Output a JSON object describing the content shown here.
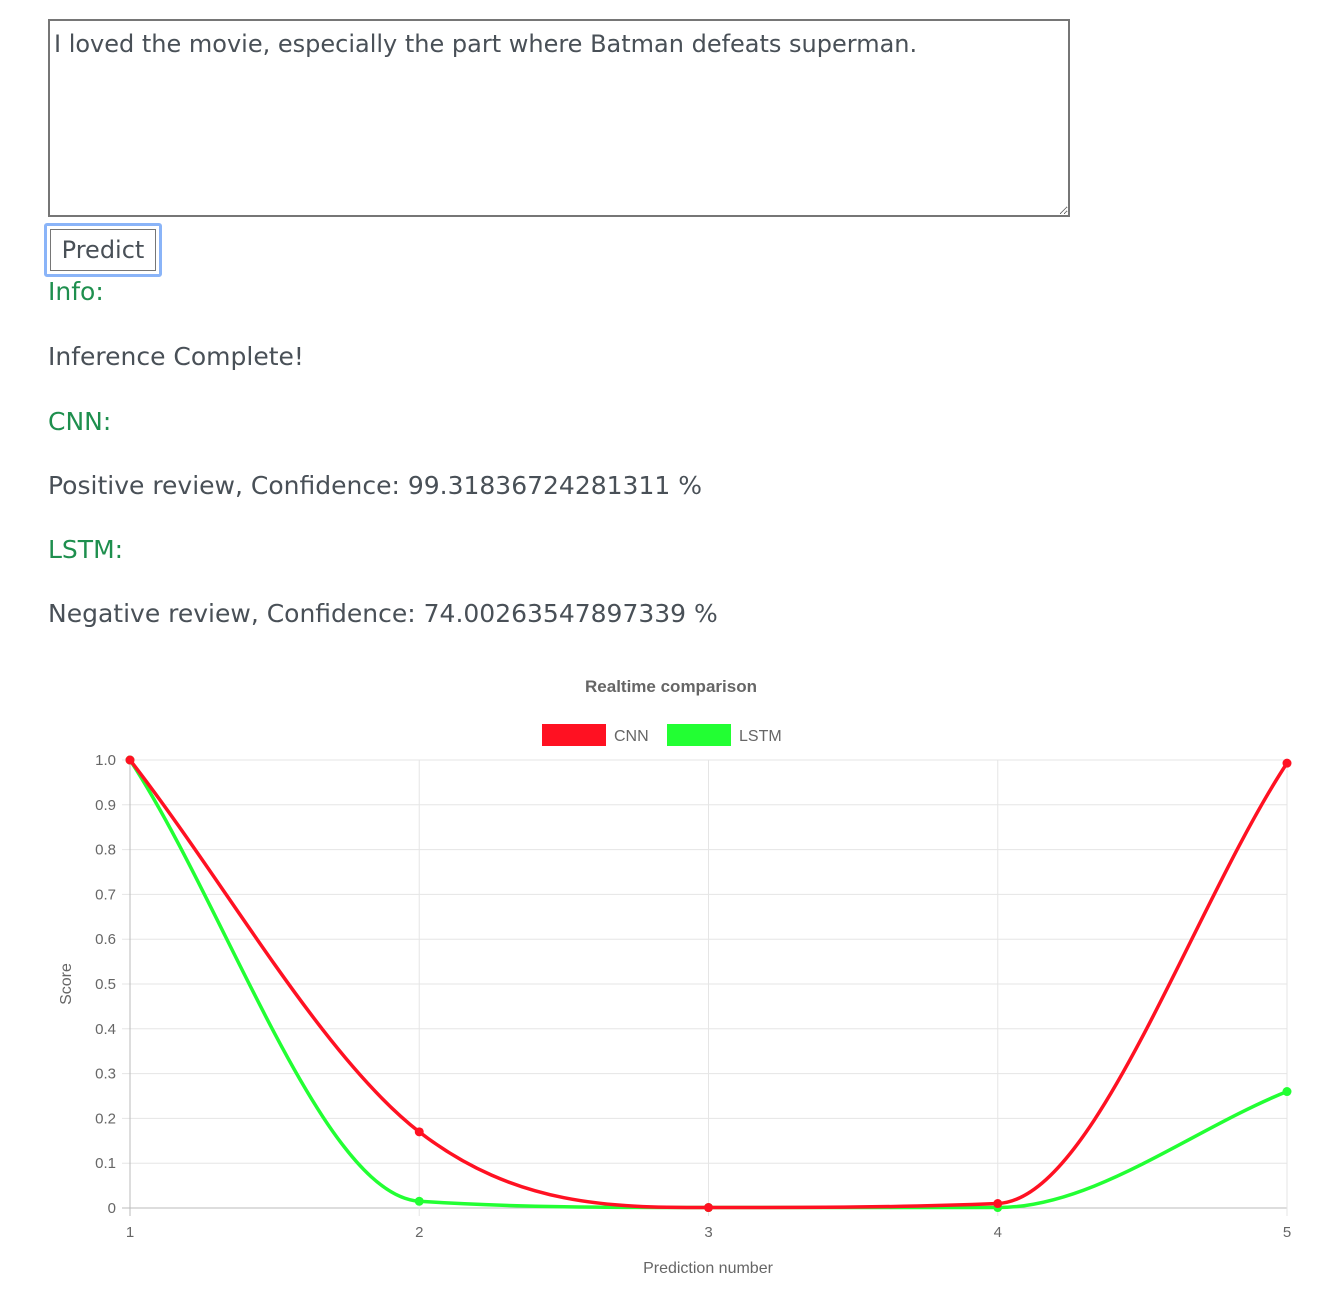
{
  "input": {
    "value": "I loved the movie, especially the part where Batman defeats superman."
  },
  "predict_button": {
    "label": "Predict"
  },
  "results": {
    "info_label": "Info:",
    "info_value": "Inference Complete!",
    "cnn_label": "CNN:",
    "cnn_value": "Positive review, Confidence: 99.31836724281311 %",
    "lstm_label": "LSTM:",
    "lstm_value": "Negative review, Confidence: 74.00263547897339 %"
  },
  "chart_data": {
    "type": "line",
    "title": "Realtime comparison",
    "xlabel": "Prediction number",
    "ylabel": "Score",
    "x": [
      1,
      2,
      3,
      4,
      5
    ],
    "ylim": [
      0,
      1
    ],
    "yticks": [
      "0",
      "0.1",
      "0.2",
      "0.3",
      "0.4",
      "0.5",
      "0.6",
      "0.7",
      "0.8",
      "0.9",
      "1.0"
    ],
    "yticks_values": [
      0,
      0.1,
      0.2,
      0.3,
      0.4,
      0.5,
      0.6,
      0.7,
      0.8,
      0.9,
      1.0
    ],
    "grid": true,
    "legend_position": "top",
    "series": [
      {
        "name": "CNN",
        "color": "#ff1122",
        "values": [
          1.0,
          0.17,
          0.001,
          0.01,
          0.993
        ]
      },
      {
        "name": "LSTM",
        "color": "#22ff33",
        "values": [
          1.0,
          0.015,
          0.001,
          0.001,
          0.26
        ]
      }
    ]
  }
}
